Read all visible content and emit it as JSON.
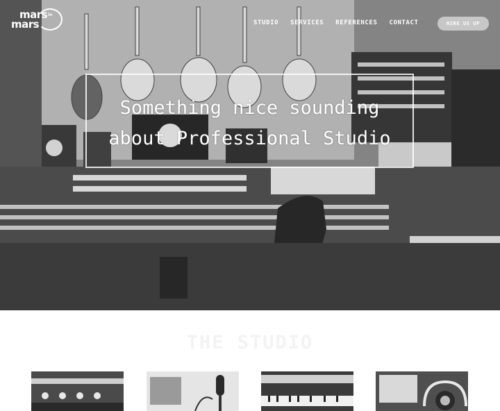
{
  "brand": {
    "logo_top": "mars",
    "logo_in": "in",
    "logo_bottom": "mars"
  },
  "nav": {
    "items": [
      {
        "label": "STUDIO"
      },
      {
        "label": "SERVICES"
      },
      {
        "label": "REFERENCES"
      },
      {
        "label": "CONTACT"
      }
    ],
    "cta_label": "HIRE US UP"
  },
  "hero": {
    "title_line1": "Something nice sounding",
    "title_line2": "about Professional Studio"
  },
  "studio_section": {
    "title": "THE STUDIO",
    "thumbnails": [
      {
        "icon": "mixing-console-photo"
      },
      {
        "icon": "microphone-photo"
      },
      {
        "icon": "keyboard-photo"
      },
      {
        "icon": "headphones-photo"
      }
    ]
  },
  "colors": {
    "hero_text": "#ffffff",
    "button_bg": "#d8d8d8",
    "page_bg": "#ffffff"
  }
}
